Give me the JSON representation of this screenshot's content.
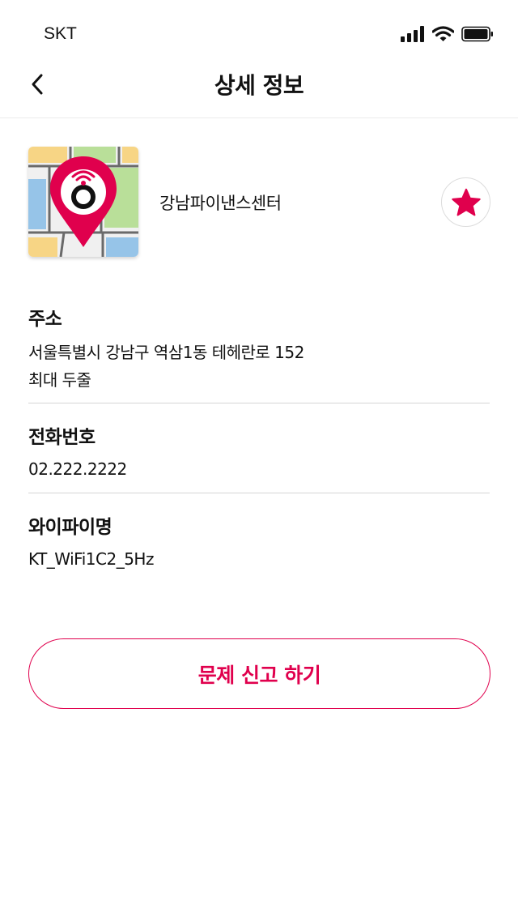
{
  "status_bar": {
    "carrier": "SKT"
  },
  "header": {
    "title": "상세 정보"
  },
  "place": {
    "name": "강남파이낸스센터",
    "favorite": true
  },
  "details": {
    "address": {
      "label": "주소",
      "line1": "서울특별시 강남구 역삼1동 테헤란로 152",
      "line2": "최대 두줄"
    },
    "phone": {
      "label": "전화번호",
      "value": "02.222.2222"
    },
    "wifi": {
      "label": "와이파이명",
      "value": "KT_WiFi1C2_5Hz"
    }
  },
  "actions": {
    "report_label": "문제 신고 하기"
  },
  "colors": {
    "accent": "#e0004d",
    "divider": "#d5d5d5"
  }
}
